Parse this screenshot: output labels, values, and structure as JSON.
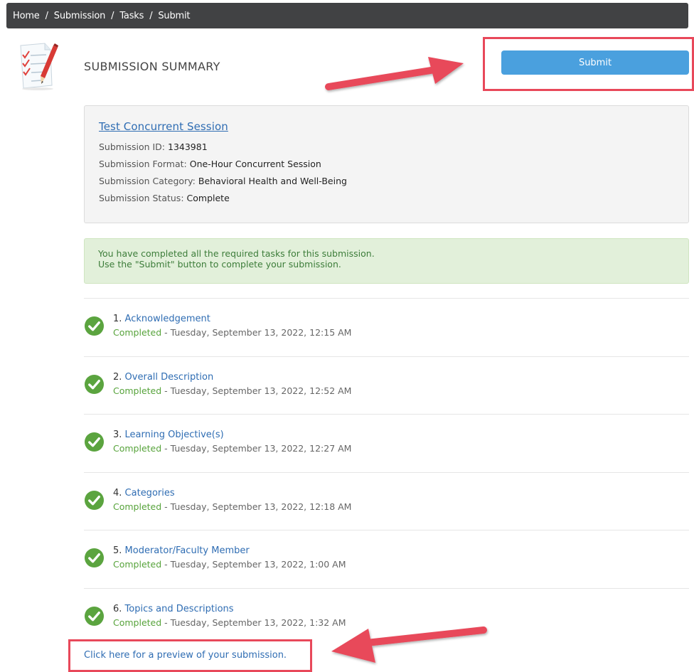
{
  "breadcrumb": [
    {
      "label": "Home"
    },
    {
      "label": "Submission"
    },
    {
      "label": "Tasks"
    },
    {
      "label": "Submit"
    }
  ],
  "breadcrumb_separator": "/",
  "page_title": "SUBMISSION SUMMARY",
  "submit_label": "Submit",
  "submission": {
    "title": "Test Concurrent Session",
    "id_label": "Submission ID:",
    "id_value": "1343981",
    "format_label": "Submission Format:",
    "format_value": "One-Hour Concurrent Session",
    "category_label": "Submission Category:",
    "category_value": "Behavioral Health and Well-Being",
    "status_label": "Submission Status:",
    "status_value": "Complete"
  },
  "alert": {
    "line1": "You have completed all the required tasks for this submission.",
    "line2": "Use the \"Submit\" button to complete your submission."
  },
  "tasks": [
    {
      "num": "1.",
      "title": "Acknowledgement",
      "status": "Completed",
      "date": " - Tuesday, September 13, 2022, 12:15 AM"
    },
    {
      "num": "2.",
      "title": "Overall Description",
      "status": "Completed",
      "date": " - Tuesday, September 13, 2022, 12:52 AM"
    },
    {
      "num": "3.",
      "title": "Learning Objective(s)",
      "status": "Completed",
      "date": " - Tuesday, September 13, 2022, 12:27 AM"
    },
    {
      "num": "4.",
      "title": "Categories",
      "status": "Completed",
      "date": " - Tuesday, September 13, 2022, 12:18 AM"
    },
    {
      "num": "5.",
      "title": "Moderator/Faculty Member",
      "status": "Completed",
      "date": " - Tuesday, September 13, 2022, 1:00 AM"
    },
    {
      "num": "6.",
      "title": "Topics and Descriptions",
      "status": "Completed",
      "date": " - Tuesday, September 13, 2022, 1:32 AM"
    }
  ],
  "preview_link": "Click here for a preview of your submission.",
  "colors": {
    "accent": "#4aa0de",
    "link": "#2f6db3",
    "success": "#57a33b",
    "highlight": "#e8485a"
  }
}
